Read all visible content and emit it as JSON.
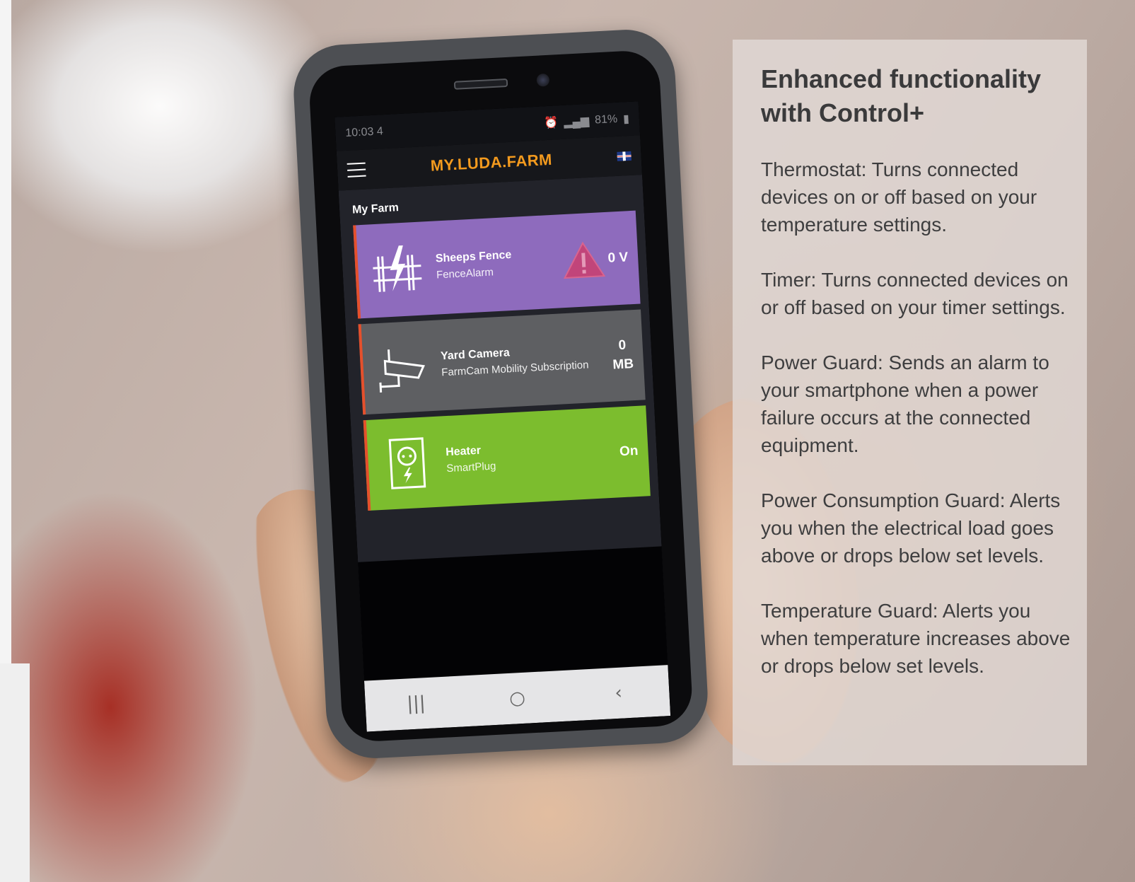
{
  "phone": {
    "status_time": "10:03",
    "status_signal": "4",
    "battery": "81%",
    "app_brand": "MY.LUDA.FARM",
    "section_title": "My Farm",
    "cards": [
      {
        "name": "Sheeps Fence",
        "sub": "FenceAlarm",
        "value": "0 V",
        "color": "#8e6bbd",
        "icon": "fence-icon",
        "alert_icon": "warning-icon"
      },
      {
        "name": "Yard Camera",
        "sub": "FarmCam Mobility Subscription",
        "value_num": "0",
        "value_unit": "MB",
        "color": "#5e5f62",
        "icon": "camera-icon"
      },
      {
        "name": "Heater",
        "sub": "SmartPlug",
        "value": "On",
        "color": "#7cbd2e",
        "icon": "smartplug-icon"
      }
    ],
    "nav": {
      "recent": "|||",
      "home": "○",
      "back": "‹"
    }
  },
  "info": {
    "title": "Enhanced functionality with Control+",
    "paragraphs": [
      "Thermostat: Turns connected devices on or off based on your temperature settings.",
      "Timer: Turns connected devices on or off based on your timer settings.",
      "Power Guard: Sends an alarm to your smartphone when a power failure occurs at the connected equipment.",
      "Power Consumption Guard: Alerts you when the electrical load goes above or drops below set levels.",
      "Temperature Guard: Alerts you when temperature increases above or drops below set levels."
    ]
  },
  "colors": {
    "brand": "#f39a1e",
    "accent_border": "#e5502c",
    "panel_text": "#3a3a3b"
  }
}
